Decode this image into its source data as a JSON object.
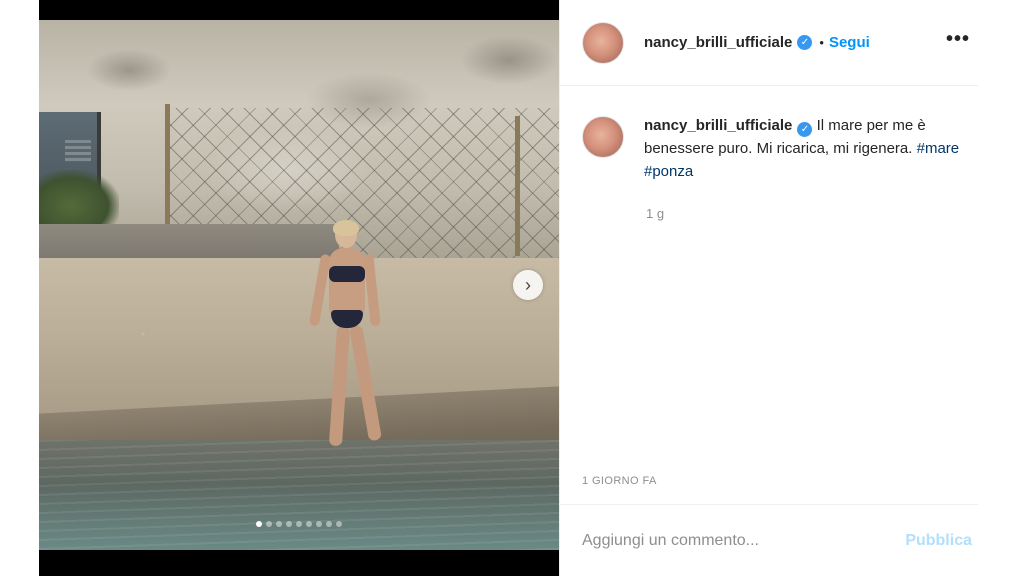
{
  "post": {
    "username": "nancy_brilli_ufficiale",
    "verified_glyph": "✓",
    "separator": "•",
    "follow_label": "Segui",
    "more_glyph": "•••",
    "caption_text": "Il mare per me è benessere puro. Mi ricarica, mi rigenera.",
    "hashtags": [
      "#mare",
      "#ponza"
    ],
    "age": "1 g",
    "timestamp": "1 GIORNO FA"
  },
  "media": {
    "next_glyph": "›",
    "slide_count": 9,
    "active_slide": 1
  },
  "comment": {
    "placeholder": "Aggiungi un commento...",
    "publish_label": "Pubblica"
  },
  "colors": {
    "accent": "#0095f6",
    "verified": "#3897f0",
    "hashtag": "#00376b",
    "muted": "#8e8e8e",
    "publish_disabled": "#b2dffc"
  },
  "icons": {
    "verified": "verified-badge-icon",
    "more": "more-options-icon",
    "next": "chevron-right-icon"
  }
}
